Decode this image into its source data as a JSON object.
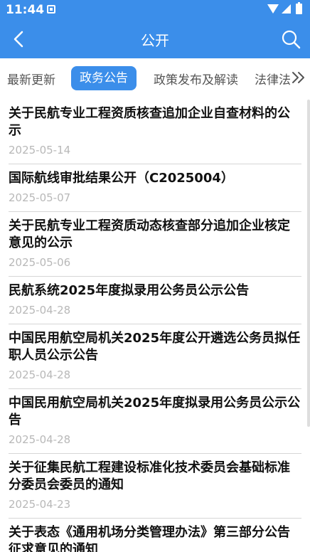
{
  "status": {
    "time": "11:44"
  },
  "appbar": {
    "title": "公开"
  },
  "tabs": [
    {
      "label": "最新更新"
    },
    {
      "label": "政务公告",
      "active": true
    },
    {
      "label": "政策发布及解读"
    },
    {
      "label": "法律法"
    }
  ],
  "articles": [
    {
      "title": "关于民航专业工程资质核查追加企业自查材料的公示",
      "date": "2025-05-14"
    },
    {
      "title": "国际航线审批结果公开（C2025004）",
      "date": "2025-05-07"
    },
    {
      "title": "关于民航专业工程资质动态核查部分追加企业核定意见的公示",
      "date": "2025-05-06"
    },
    {
      "title": "民航系统2025年度拟录用公务员公示公告",
      "date": "2025-04-28"
    },
    {
      "title": "中国民用航空局机关2025年度公开遴选公务员拟任职人员公示公告",
      "date": "2025-04-28"
    },
    {
      "title": "中国民用航空局机关2025年度拟录用公务员公示公告",
      "date": "2025-04-28"
    },
    {
      "title": "关于征集民航工程建设标准化技术委员会基础标准分委员会委员的通知",
      "date": "2025-04-23"
    },
    {
      "title": "关于表态《通用机场分类管理办法》第三部分公告征求意见的通知",
      "date": ""
    }
  ],
  "colors": {
    "primary": "#3b8eea",
    "date": "#b8b8b8"
  }
}
